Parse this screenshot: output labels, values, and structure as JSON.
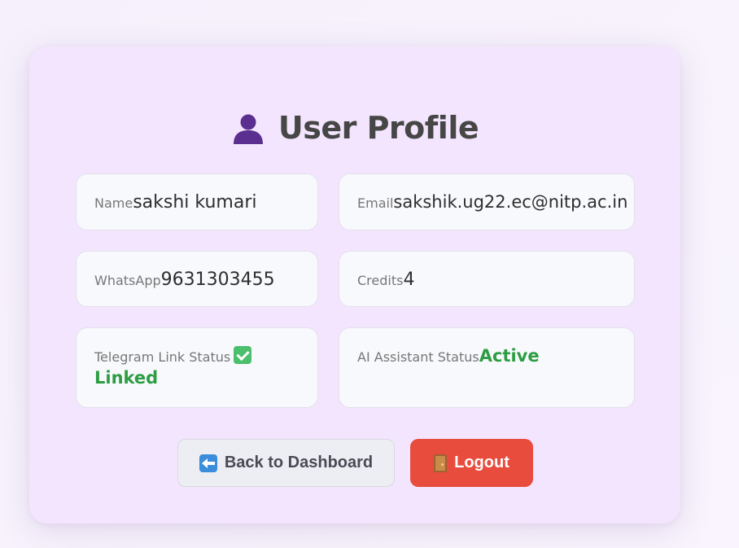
{
  "page": {
    "title": "User Profile",
    "title_icon": "user-bust-icon"
  },
  "fields": {
    "name": {
      "label": "Name",
      "value": "sakshi kumari"
    },
    "email": {
      "label": "Email",
      "value": "sakshik.ug22.ec@nitp.ac.in"
    },
    "whatsapp": {
      "label": "WhatsApp",
      "value": "9631303455"
    },
    "credits": {
      "label": "Credits",
      "value": "4"
    },
    "telegram": {
      "label": "Telegram Link Status",
      "icon": "check-mark-icon",
      "value": "Linked"
    },
    "ai_assistant": {
      "label": "AI Assistant Status",
      "value": "Active"
    }
  },
  "buttons": {
    "back": {
      "label": "Back to Dashboard",
      "icon": "left-arrow-icon"
    },
    "logout": {
      "label": "Logout",
      "icon": "door-icon"
    }
  },
  "colors": {
    "card_background": "#f3e5fd",
    "status_green": "#2d9d43",
    "logout_red": "#e84c3d",
    "title_icon_purple": "#5b2f8f"
  }
}
